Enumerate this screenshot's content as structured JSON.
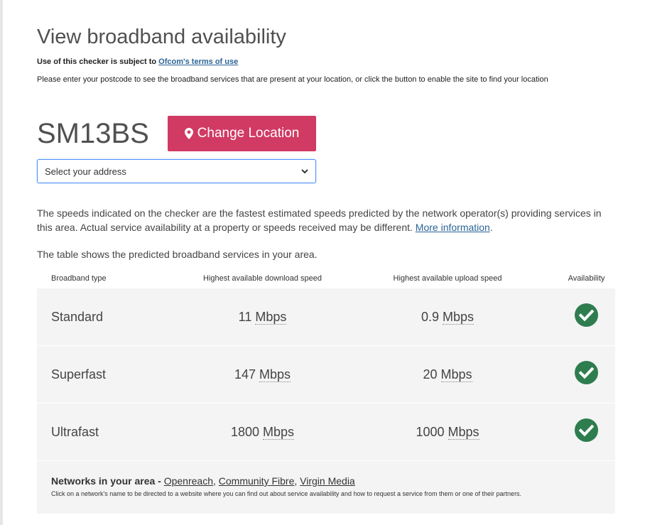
{
  "header": {
    "title": "View broadband availability",
    "terms_prefix": "Use of this checker is subject to ",
    "terms_link": "Ofcom's terms of use",
    "instructions": "Please enter your postcode to see the broadband services that are present at your location, or click the button to enable the site to find your location"
  },
  "location": {
    "postcode": "SM13BS",
    "change_button": "Change Location",
    "address_select": "Select your address"
  },
  "disclaimer": {
    "text": "The speeds indicated on the checker are the fastest estimated speeds predicted by the network operator(s) providing services in this area. Actual service availability at a property or speeds received may be different. ",
    "link": "More information",
    "end": "."
  },
  "table_intro": "The table shows the predicted broadband services in your area.",
  "table": {
    "headers": [
      "Broadband type",
      "Highest available download speed",
      "Highest available upload speed",
      "Availability"
    ],
    "rows": [
      {
        "type": "Standard",
        "down": "11",
        "down_unit": "Mbps",
        "up": "0.9",
        "up_unit": "Mbps",
        "available": true
      },
      {
        "type": "Superfast",
        "down": "147",
        "down_unit": "Mbps",
        "up": "20",
        "up_unit": "Mbps",
        "available": true
      },
      {
        "type": "Ultrafast",
        "down": "1800",
        "down_unit": "Mbps",
        "up": "1000",
        "up_unit": "Mbps",
        "available": true
      }
    ]
  },
  "networks": {
    "label": "Networks in your area - ",
    "items": [
      "Openreach",
      "Community Fibre",
      "Virgin Media"
    ],
    "note": "Click on a network's name to be directed to a website where you can find out about service availability and how to request a service from them or one of their partners."
  },
  "colors": {
    "button": "#d13a63",
    "check": "#2e7d4f",
    "link": "#2a6496",
    "row_bg": "#f4f4f4"
  },
  "icons": {
    "change_button": "map-marker-icon",
    "select": "chevron-down-icon",
    "availability": "check-circle-icon"
  }
}
